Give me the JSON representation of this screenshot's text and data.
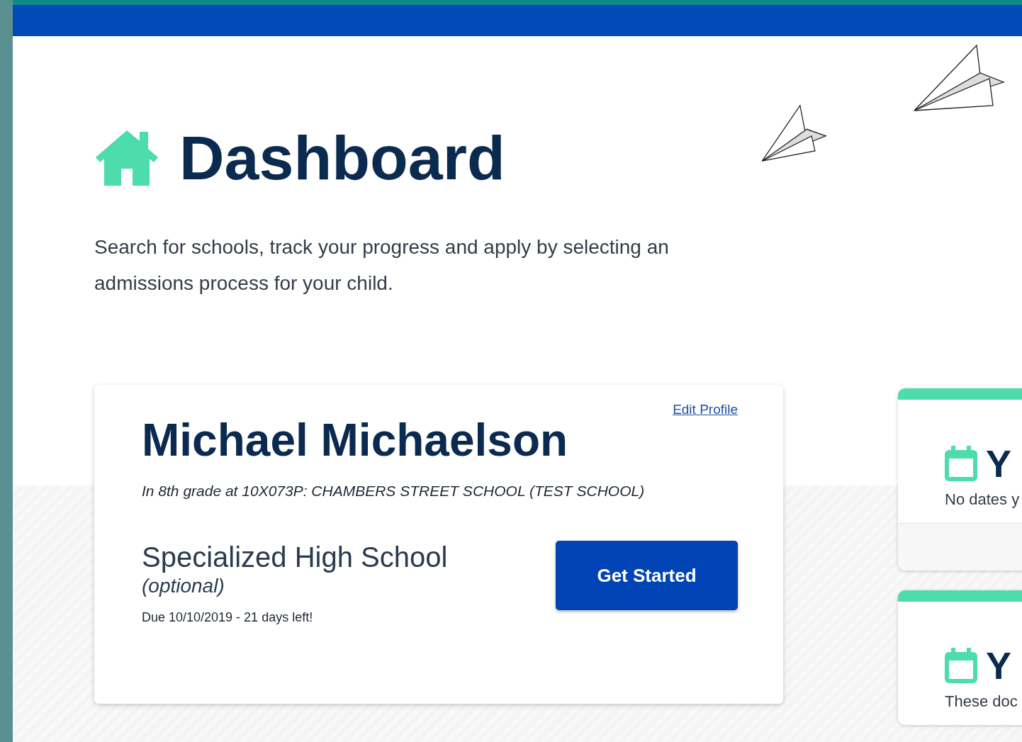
{
  "header": {
    "title": "Dashboard",
    "description": "Search for schools, track your progress and apply by selecting an admissions process for your child."
  },
  "profile_card": {
    "edit_link": "Edit Profile",
    "name": "Michael Michaelson",
    "grade_info": "In 8th grade at 10X073P: CHAMBERS STREET SCHOOL (TEST SCHOOL)",
    "process": {
      "title": "Specialized High School",
      "note": "(optional)",
      "due": "Due 10/10/2019 - 21 days left!",
      "button": "Get Started"
    }
  },
  "side_cards": [
    {
      "title": "Y",
      "text": "No dates y",
      "footer": true
    },
    {
      "title": "Y",
      "text": "These doc",
      "footer": false
    }
  ]
}
